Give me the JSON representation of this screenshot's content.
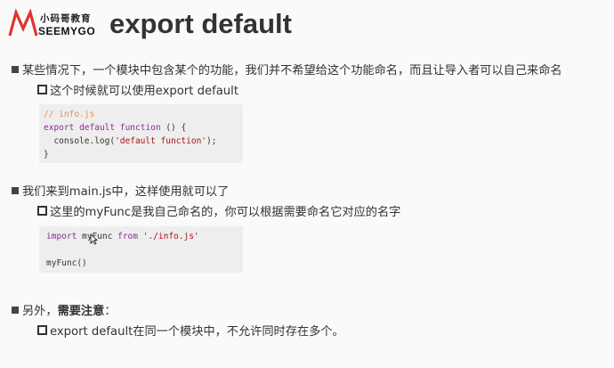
{
  "brand": {
    "name_cn": "小码哥教育",
    "name_en": "SEEMYGO"
  },
  "title": "export default",
  "colors": {
    "logo_red": "#e0342d",
    "keyword": "#8a2b8f",
    "string": "#a31515",
    "comment": "#e0914a"
  },
  "sections": [
    {
      "bullet": "某些情况下，一个模块中包含某个的功能，我们并不希望给这个功能命名，而且让导入者可以自己来命名",
      "sub": "这个时候就可以使用export default",
      "code": [
        [
          {
            "t": "// info.js",
            "c": "cm"
          }
        ],
        [
          {
            "t": "export",
            "c": "kw"
          },
          {
            "t": " ",
            "c": "pl"
          },
          {
            "t": "default",
            "c": "kw"
          },
          {
            "t": " ",
            "c": "pl"
          },
          {
            "t": "function",
            "c": "kw"
          },
          {
            "t": " () {",
            "c": "pl"
          }
        ],
        [
          {
            "t": "  console.log(",
            "c": "pl"
          },
          {
            "t": "'default function'",
            "c": "str"
          },
          {
            "t": ");",
            "c": "pl"
          }
        ],
        [
          {
            "t": "}",
            "c": "pl"
          }
        ]
      ]
    },
    {
      "bullet": "我们来到main.js中，这样使用就可以了",
      "sub": "这里的myFunc是我自己命名的，你可以根据需要命名它对应的名字",
      "code": [
        [
          {
            "t": "import",
            "c": "kw"
          },
          {
            "t": " myFunc ",
            "c": "pl"
          },
          {
            "t": "from",
            "c": "kw"
          },
          {
            "t": " ",
            "c": "pl"
          },
          {
            "t": "'./info.js'",
            "c": "str"
          }
        ],
        [
          {
            "t": "",
            "c": "pl"
          }
        ],
        [
          {
            "t": "myFunc()",
            "c": "pl"
          }
        ]
      ]
    },
    {
      "bullet_prefix": "另外，",
      "bullet_strong": "需要注意",
      "bullet_suffix": "：",
      "sub": "export default在同一个模块中，不允许同时存在多个。"
    }
  ]
}
